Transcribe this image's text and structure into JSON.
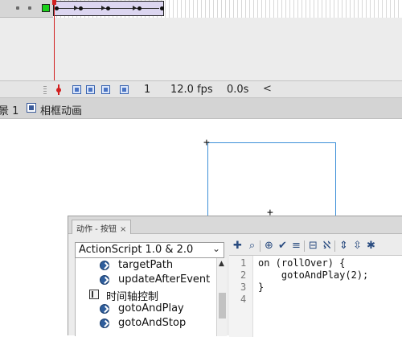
{
  "timeline": {
    "frame_number": "1",
    "fps": "12.0 fps",
    "elapsed": "0.0s",
    "scroll_left": "<"
  },
  "breadcrumb": {
    "scene": "景 1",
    "symbol": "相框动画"
  },
  "actions_panel": {
    "tab_label": "动作 - 按钮",
    "tab_close": "×",
    "version": "ActionScript 1.0 & 2.0",
    "list_items": [
      {
        "label": "targetPath",
        "icon": "action-icon"
      },
      {
        "label": "updateAfterEvent",
        "icon": "action-icon"
      },
      {
        "label": "时间轴控制",
        "icon": "book-icon"
      },
      {
        "label": "gotoAndPlay",
        "icon": "action-icon"
      },
      {
        "label": "gotoAndStop",
        "icon": "action-icon"
      }
    ],
    "toolbar_icons": [
      "add-action-icon",
      "find-icon",
      "target-icon",
      "check-syntax-icon",
      "auto-format-icon",
      "code-hint-icon",
      "debug-icon",
      "collapse-icon",
      "expand-icon",
      "collapse-all-icon"
    ],
    "code_lines": [
      {
        "num": "1",
        "text": "on (rollOver) {"
      },
      {
        "num": "2",
        "text": "    gotoAndPlay(2);"
      },
      {
        "num": "3",
        "text": "}"
      },
      {
        "num": "4",
        "text": ""
      }
    ]
  },
  "colors": {
    "playhead": "#d11f1f",
    "stage_outline": "#3d8fd8",
    "layer_outline": "#1bd11b"
  }
}
